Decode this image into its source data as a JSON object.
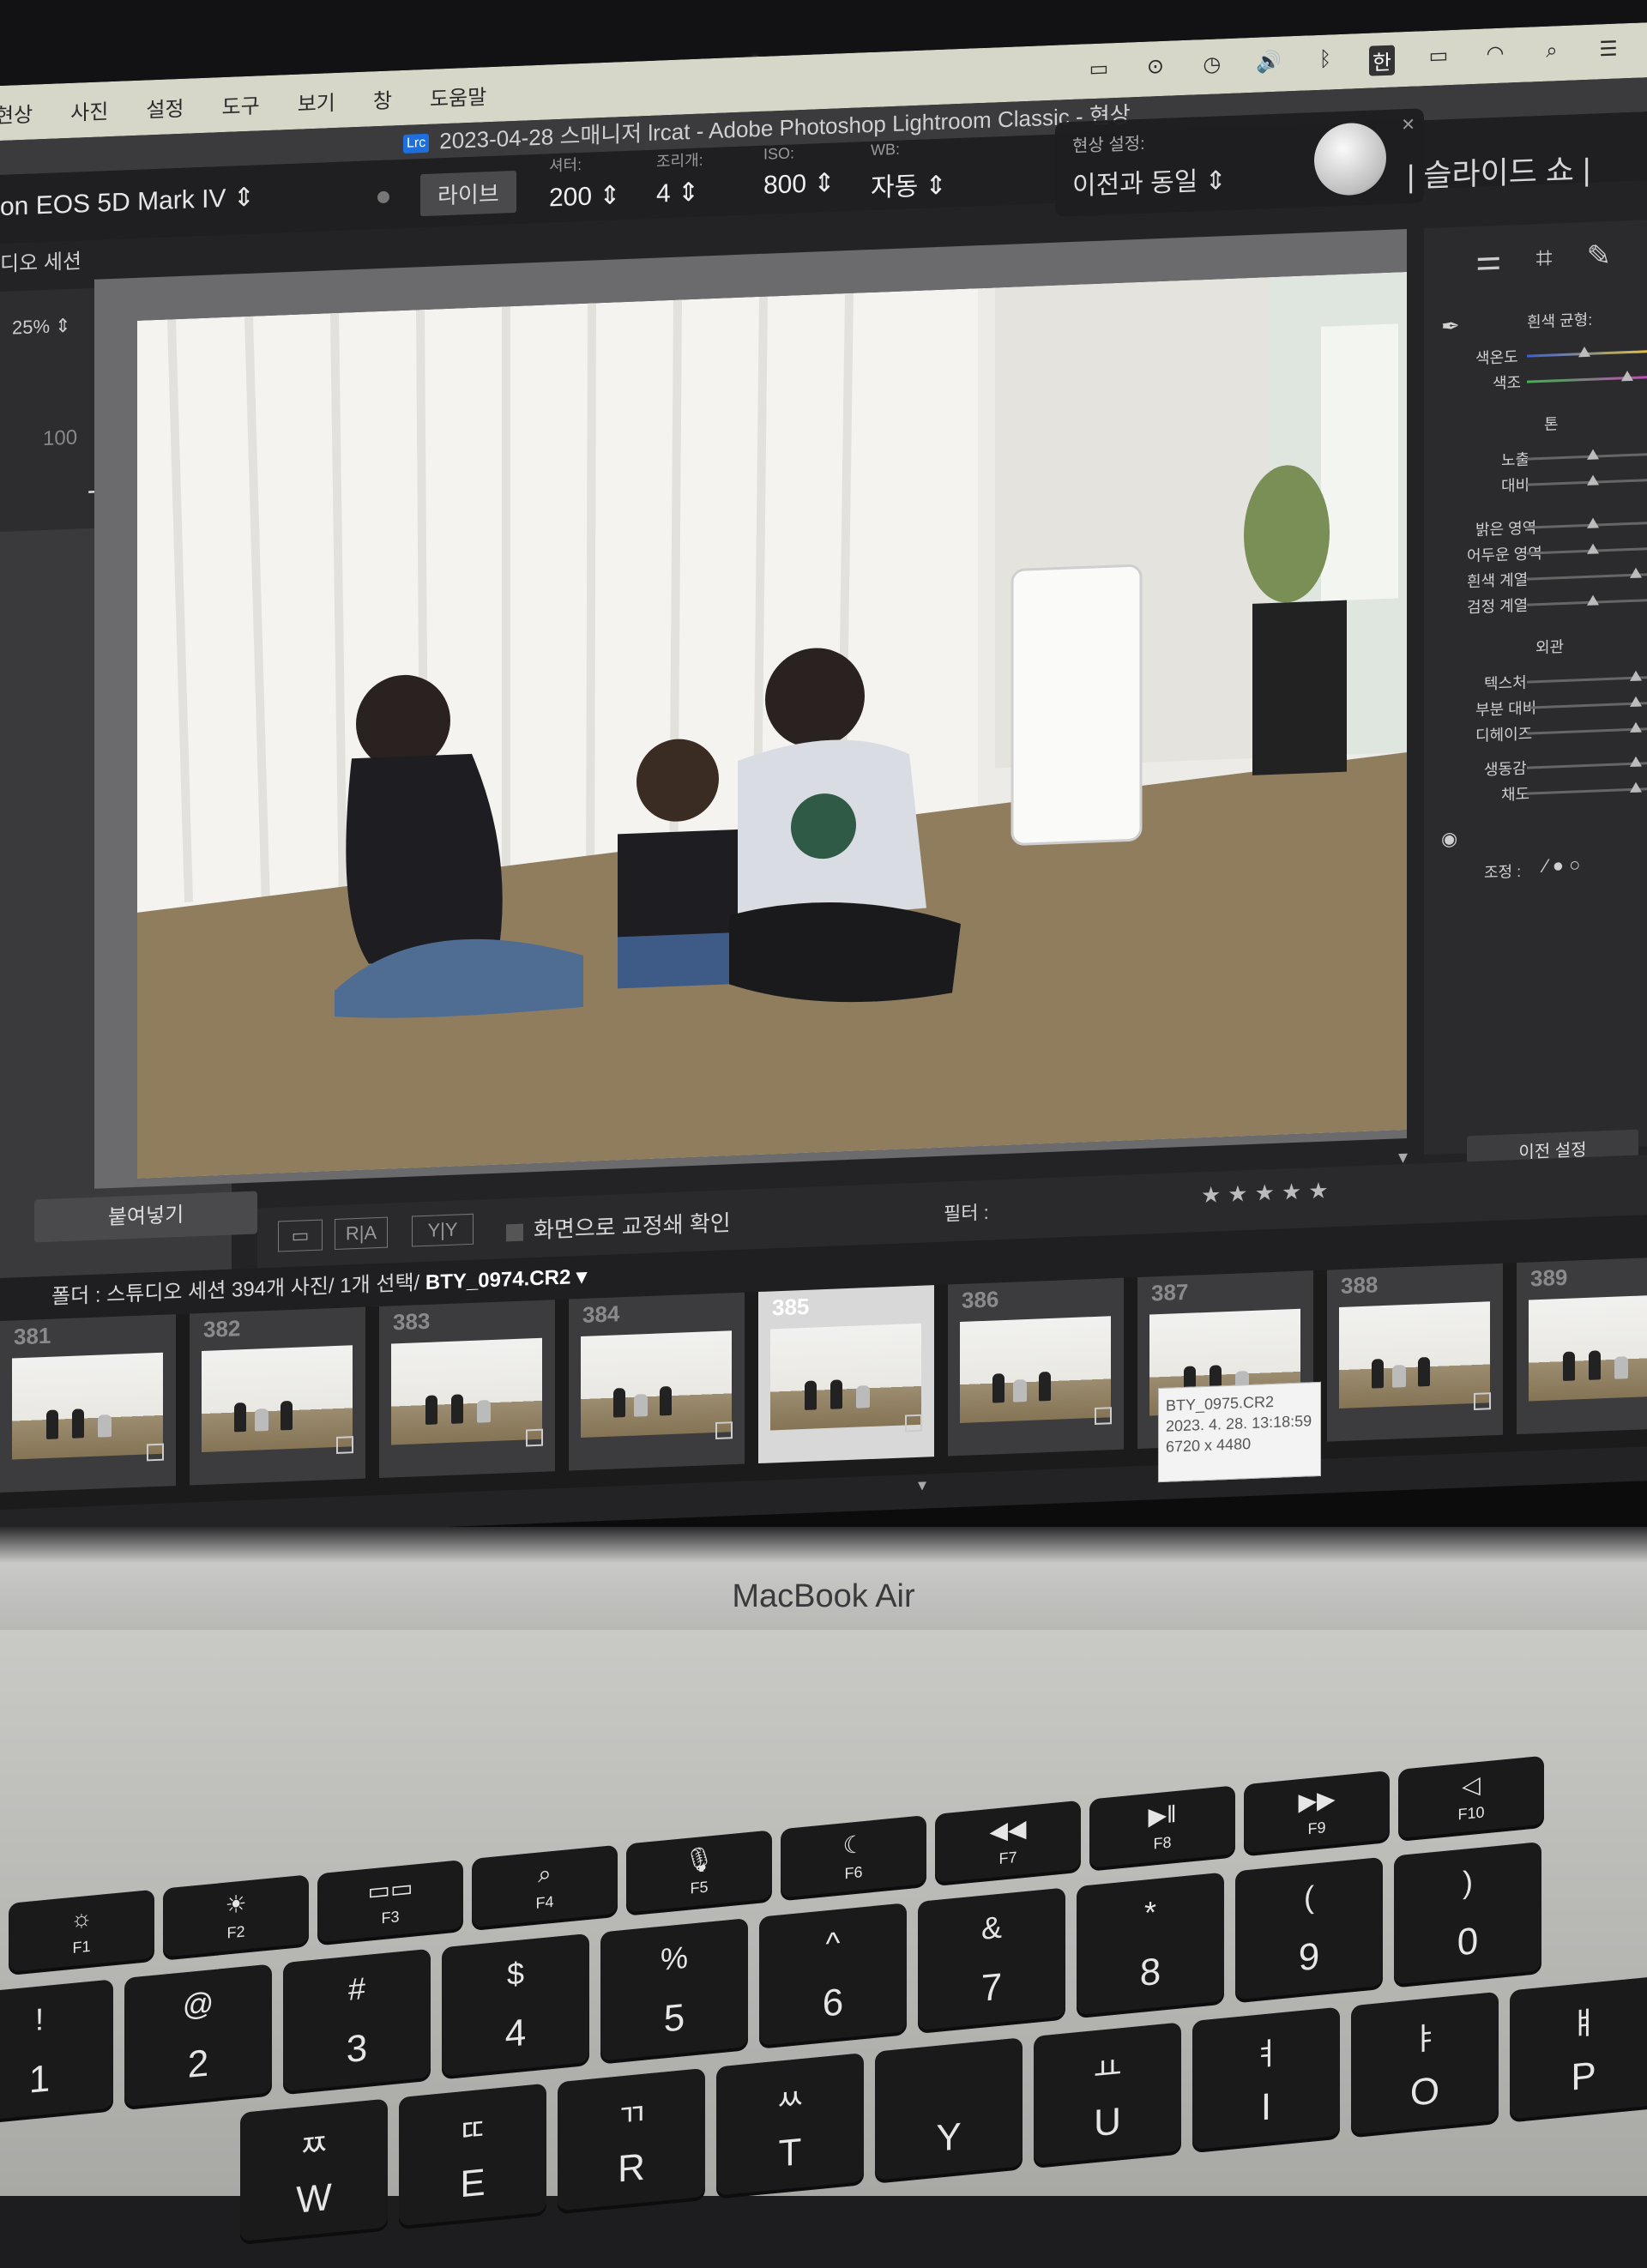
{
  "menubar": {
    "menus": [
      "현상",
      "사진",
      "설정",
      "도구",
      "보기",
      "창",
      "도움말"
    ],
    "ime": "한"
  },
  "window": {
    "title": "2023-04-28 스매니저 lrcat - Adobe Photoshop Lightroom Classic - 현상",
    "app_badge": "Lrc"
  },
  "toolbar": {
    "camera": "on EOS 5D Mark IV ⇕",
    "live_button": "라이브",
    "shutter_label": "셔터:",
    "shutter_value": "200 ⇕",
    "aperture_label": "조리개:",
    "aperture_value": "4 ⇕",
    "iso_label": "ISO:",
    "iso_value": "800 ⇕",
    "wb_label": "WB:",
    "wb_value": "자동 ⇕",
    "develop_label": "현상 설정:",
    "develop_value": "이전과 동일 ⇕",
    "studio_session": "디오 세션"
  },
  "modules": "| 슬라이드 쇼 |",
  "left_panel": {
    "zoom": "25% ⇕",
    "value": "100",
    "add_icon": "+.",
    "paste_button": "붙여넣기"
  },
  "bottom_bar": {
    "view_ra": "R|A",
    "view_yy": "Y|Y",
    "soft_proof": "화면으로 교정쇄 확인",
    "filter_label": "필터 :",
    "stars": "★★★★★"
  },
  "filmstrip": {
    "info_prefix": "폴더 : 스튜디오 세션   394개 사진/ 1개 선택/",
    "selected_file": "BTY_0974.CR2 ▾",
    "thumbs": [
      {
        "num": "381"
      },
      {
        "num": "382"
      },
      {
        "num": "383"
      },
      {
        "num": "384"
      },
      {
        "num": "385"
      },
      {
        "num": "386"
      },
      {
        "num": "387"
      },
      {
        "num": "388"
      },
      {
        "num": "389"
      }
    ],
    "tooltip_name": "BTY_0975.CR2",
    "tooltip_date": "2023. 4. 28. 13:18:59",
    "tooltip_size": "6720 x 4480"
  },
  "right_panel": {
    "wb_heading": "흰색 균형:",
    "temp": "색온도",
    "tint": "색조",
    "tone_heading": "톤",
    "exposure": "노출",
    "contrast": "대비",
    "highlights": "밝은 영역",
    "shadows": "어두운 영역",
    "whites": "흰색 계열",
    "blacks": "검정 계열",
    "presence_heading": "외관",
    "texture": "텍스처",
    "clarity": "부분 대비",
    "dehaze": "디헤이즈",
    "vibrance": "생동감",
    "saturation": "채도",
    "adjust": "조정 :",
    "prev_button": "이전 설정"
  },
  "laptop": {
    "brand": "MacBook Air"
  },
  "keyboard": {
    "fkeys": [
      {
        "icon": "☼",
        "fn": "F1"
      },
      {
        "icon": "☀",
        "fn": "F2"
      },
      {
        "icon": "▭▭",
        "fn": "F3"
      },
      {
        "icon": "⌕",
        "fn": "F4"
      },
      {
        "icon": "🎙",
        "fn": "F5"
      },
      {
        "icon": "☾",
        "fn": "F6"
      },
      {
        "icon": "◀◀",
        "fn": "F7"
      },
      {
        "icon": "▶‖",
        "fn": "F8"
      },
      {
        "icon": "▶▶",
        "fn": "F9"
      },
      {
        "icon": "◁",
        "fn": "F10"
      }
    ],
    "numkeys": [
      {
        "top": "!",
        "bot": "1"
      },
      {
        "top": "@",
        "bot": "2"
      },
      {
        "top": "#",
        "bot": "3"
      },
      {
        "top": "$",
        "bot": "4"
      },
      {
        "top": "%",
        "bot": "5"
      },
      {
        "top": "^",
        "bot": "6"
      },
      {
        "top": "&",
        "bot": "7"
      },
      {
        "top": "*",
        "bot": "8"
      },
      {
        "top": "(",
        "bot": "9"
      },
      {
        "top": ")",
        "bot": "0"
      }
    ],
    "letterkeys": [
      {
        "top": "ㅉ",
        "bot": "W"
      },
      {
        "top": "ㄸ",
        "bot": "E"
      },
      {
        "top": "ㄲ",
        "bot": "R"
      },
      {
        "top": "ㅆ",
        "bot": "T"
      },
      {
        "top": "",
        "bot": "Y"
      },
      {
        "top": "ㅛ",
        "bot": "U"
      },
      {
        "top": "ㅕ",
        "bot": "I"
      },
      {
        "top": "ㅑ",
        "bot": "O"
      },
      {
        "top": "ㅒ",
        "bot": "P"
      }
    ]
  }
}
